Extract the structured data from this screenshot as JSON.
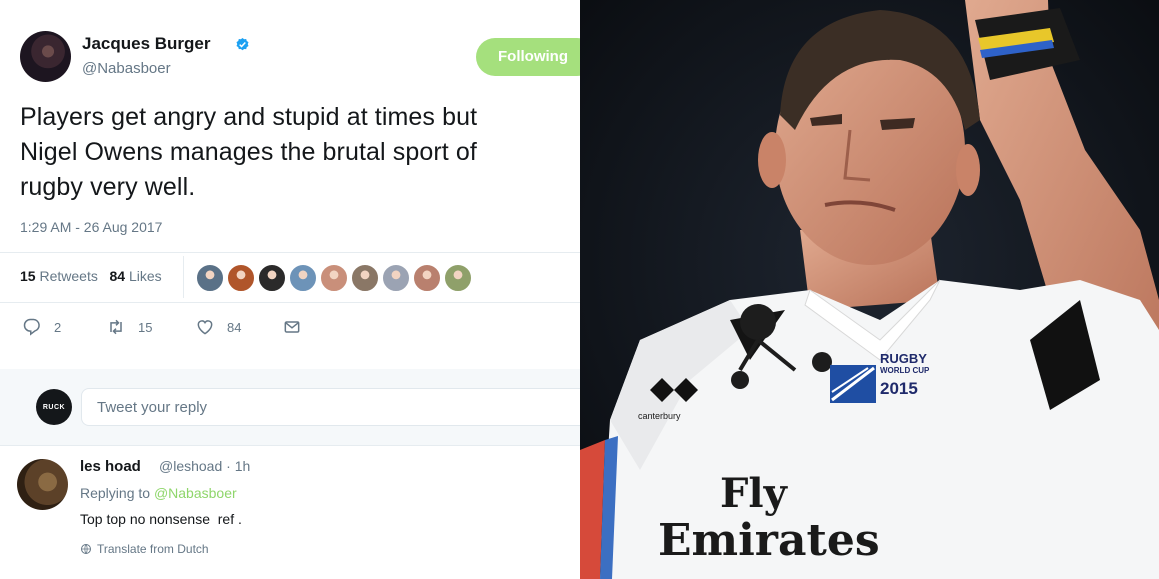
{
  "tweet": {
    "author_name": "Jacques Burger",
    "author_handle": "@Nabasboer",
    "follow_label": "Following",
    "text_lines": [
      "Players get angry and stupid at times but",
      "Nigel Owens manages the brutal sport of",
      "rugby very well."
    ],
    "timestamp": "1:29 AM - 26 Aug 2017",
    "retweet_count": "15",
    "retweet_label": "Retweets",
    "like_count": "84",
    "like_label": "Likes",
    "liker_colors": [
      "#5a7187",
      "#b0552a",
      "#2b2a2a",
      "#6d93b8",
      "#c98f7a",
      "#8a7766",
      "#9ba3b3",
      "#b9806e",
      "#8fa06a"
    ]
  },
  "actions": {
    "reply_count": "2",
    "retweet_count": "15",
    "like_count": "84"
  },
  "reply_box": {
    "avatar_text": "RUCK",
    "placeholder": "Tweet your reply"
  },
  "comment": {
    "name": "les hoad",
    "handle_time": "@leshoad · 1h",
    "replying_prefix": "Replying to",
    "replying_mention": "@Nabasboer",
    "text": "Top top no nonsense  ref .",
    "translate_label": "Translate from Dutch"
  },
  "photo": {
    "rwc_line1": "RUGBY",
    "rwc_line2": "WORLD CUP",
    "rwc_year": "2015",
    "kit_brand": "canterbury",
    "sponsor_line1": "Fly",
    "sponsor_line2": "Emirates"
  },
  "colors": {
    "accent_green": "#a5e07d",
    "mention_green": "#8fd66b",
    "muted_text": "#657786",
    "verified_blue": "#1da1f2"
  }
}
